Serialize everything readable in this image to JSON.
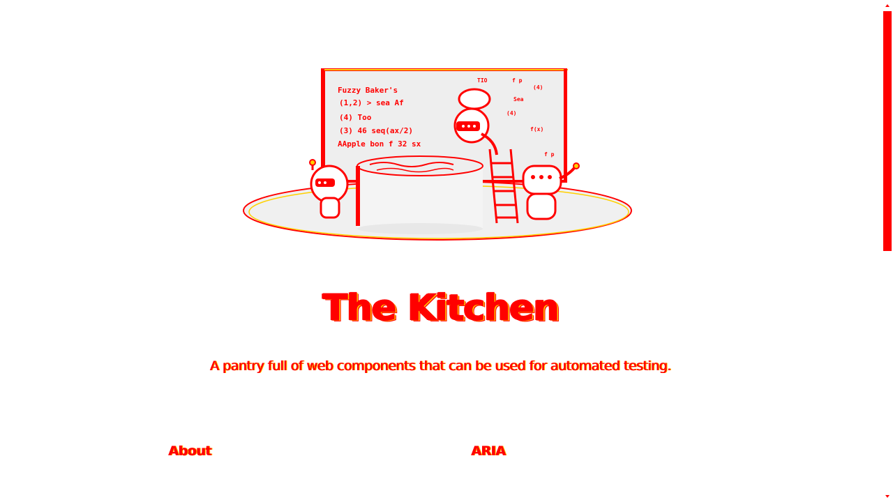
{
  "page": {
    "title": "The Kitchen",
    "subtitle": "A pantry full of web components that can be used for automated testing.",
    "sections": [
      {
        "label": "About"
      },
      {
        "label": "ARIA"
      }
    ]
  },
  "illustration": {
    "board_lines": [
      "Fuzzy Baker's",
      "(1,2) > sea Af",
      "(4) Too",
      "(3) 46 seq(ax/2)",
      "AApple bon f 32 sx"
    ],
    "board_right": [
      "TIO",
      "f p",
      "(4)",
      "Sea",
      "(4)",
      "f(x)",
      "f p"
    ],
    "colors": {
      "accent": "#ff0000",
      "highlight": "#ffd000",
      "fill": "#eeeeee"
    }
  },
  "scrollbar": {
    "up_icon": "arrow-up-icon",
    "down_icon": "arrow-down-icon"
  }
}
